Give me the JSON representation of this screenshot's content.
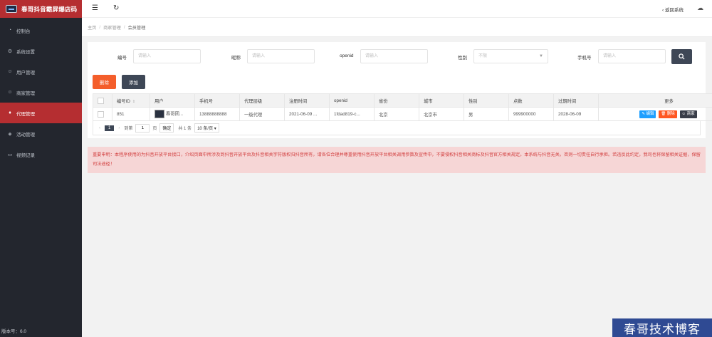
{
  "brand": {
    "name": "春哥抖音霸屏爆店码"
  },
  "sidebar": {
    "items": [
      {
        "label": "控制台",
        "icon": "dashboard-icon",
        "glyph": "◔"
      },
      {
        "label": "系统设置",
        "icon": "gear-icon",
        "glyph": "⚙"
      },
      {
        "label": "用户管理",
        "icon": "user-icon",
        "glyph": "☺"
      },
      {
        "label": "商家管理",
        "icon": "smile-icon",
        "glyph": "☺"
      },
      {
        "label": "代理管理",
        "icon": "diamond-icon",
        "glyph": "♦",
        "active": true
      },
      {
        "label": "活动管理",
        "icon": "tag-icon",
        "glyph": "◈"
      },
      {
        "label": "视频记录",
        "icon": "video-icon",
        "glyph": "▭"
      }
    ],
    "version": "版本号：6.0"
  },
  "header": {
    "back_label": "返回系统"
  },
  "breadcrumb": {
    "home": "主页",
    "section": "商家管理",
    "current": "会员管理"
  },
  "search": {
    "fields": [
      {
        "label": "编号",
        "placeholder": "请输入"
      },
      {
        "label": "昵称",
        "placeholder": "请输入"
      },
      {
        "label": "openid",
        "placeholder": "请输入"
      },
      {
        "label": "性别",
        "placeholder": "不限"
      },
      {
        "label": "手机号",
        "placeholder": "请输入"
      }
    ]
  },
  "actions": {
    "delete": "删除",
    "add": "添加"
  },
  "table": {
    "columns": [
      "编号ID",
      "用户",
      "手机号",
      "代理层级",
      "注册时间",
      "openid",
      "省份",
      "城市",
      "性别",
      "点数",
      "过期时间",
      "更多"
    ],
    "rows": [
      {
        "id": "851",
        "user": "春哥团...",
        "phone": "13888888888",
        "level": "一级代理",
        "registered": "2021-06-09 ...",
        "openid": "1fdad819-c...",
        "province": "北京",
        "city": "北京市",
        "gender": "男",
        "points": "999900000",
        "expires": "2028-06-09"
      }
    ],
    "row_actions": {
      "edit": "编辑",
      "delete": "删除",
      "merchant": "商家"
    }
  },
  "pager": {
    "current": "1",
    "goto_label": "到第",
    "page_value": "1",
    "page_unit": "页",
    "confirm": "确定",
    "total": "共 1 条",
    "page_size": "10 条/页"
  },
  "notice": "重要申明：本程序使用的为抖音开放平台接口，介绍页面中所涉及到抖音开放平台及抖音相关字符版权归抖音所有，请各位合理并尊重使用抖音开放平台相关调用参数及宣传中，不要侵权抖音相关商标及抖音官方相关规定。本系统与抖音无关。否则一切责任自行承担。若违反此约定，我司也将保留相关证据，保留司法途径！",
  "watermark": "春哥技术博客"
}
